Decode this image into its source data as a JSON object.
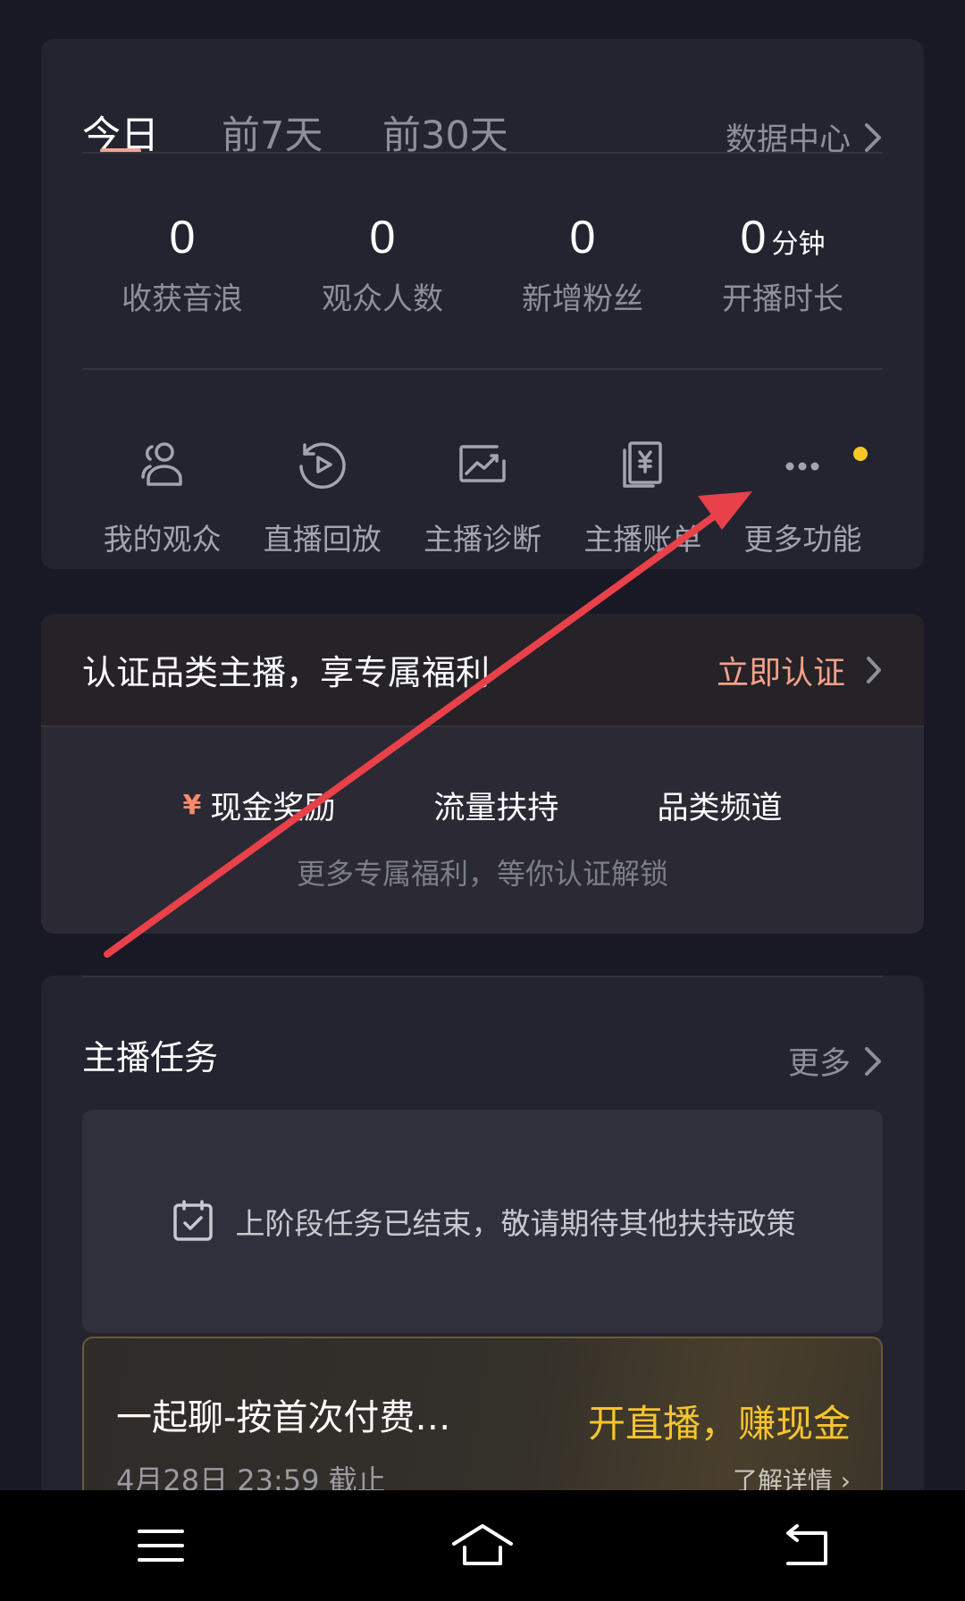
{
  "stats_card": {
    "tabs": [
      {
        "label": "今日",
        "active": true
      },
      {
        "label": "前7天",
        "active": false
      },
      {
        "label": "前30天",
        "active": false
      }
    ],
    "data_center_label": "数据中心",
    "stats": [
      {
        "value": "0",
        "unit": "",
        "label": "收获音浪"
      },
      {
        "value": "0",
        "unit": "",
        "label": "观众人数"
      },
      {
        "value": "0",
        "unit": "",
        "label": "新增粉丝"
      },
      {
        "value": "0",
        "unit": "分钟",
        "label": "开播时长"
      }
    ],
    "tools": [
      {
        "label": "我的观众",
        "icon": "audience-icon"
      },
      {
        "label": "直播回放",
        "icon": "replay-icon"
      },
      {
        "label": "主播诊断",
        "icon": "diagnosis-icon"
      },
      {
        "label": "主播账单",
        "icon": "bill-icon"
      },
      {
        "label": "更多功能",
        "icon": "more-icon",
        "has_notification": true
      }
    ]
  },
  "certification": {
    "title": "认证品类主播，享专属福利",
    "action_label": "立即认证",
    "benefits": [
      {
        "label": "现金奖励",
        "icon": "yen-icon"
      },
      {
        "label": "流量扶持"
      },
      {
        "label": "品类频道"
      }
    ],
    "subtitle": "更多专属福利，等你认证解锁"
  },
  "tasks": {
    "title": "主播任务",
    "more_label": "更多",
    "notice": "上阶段任务已结束，敬请期待其他扶持政策",
    "promo": {
      "title": "一起聊-按首次付费…",
      "deadline": "4月28日 23:59 截止",
      "cta": "开直播，赚现金",
      "detail_label": "了解详情 ›"
    }
  },
  "colors": {
    "background": "#181924",
    "card": "#232430",
    "accent_orange": "#f3a28a",
    "accent_gold": "#f6c42c",
    "annotation_arrow": "#e8414a",
    "notification_dot": "#f6c924"
  },
  "nav": {
    "buttons": [
      "menu-icon",
      "home-icon",
      "back-icon"
    ]
  }
}
